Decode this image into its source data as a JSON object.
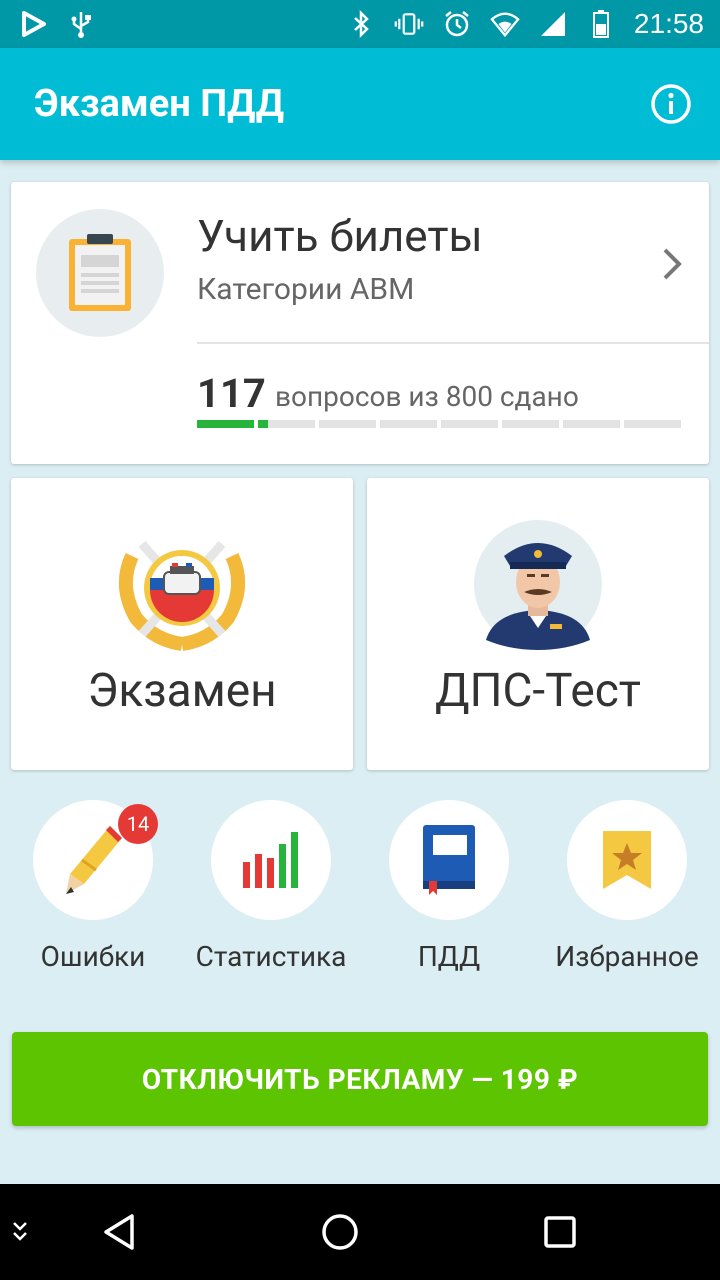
{
  "status_bar": {
    "time": "21:58",
    "icons": [
      "play-store-icon",
      "usb-icon",
      "bluetooth-icon",
      "vibrate-icon",
      "alarm-icon",
      "wifi-icon",
      "signal-icon",
      "battery-icon"
    ]
  },
  "app_bar": {
    "title": "Экзамен ПДД",
    "info_icon": "info-icon"
  },
  "learn_card": {
    "title": "Учить билеты",
    "subtitle": "Категории ABM",
    "passed_count": "117",
    "passed_text": "вопросов из 800 сдано",
    "progress_fraction": 0.146,
    "segments": 8,
    "accent_color": "#27b43a"
  },
  "exam_card": {
    "label": "Экзамен",
    "icon": "police-emblem-icon"
  },
  "dps_card": {
    "label": "ДПС-Тест",
    "icon": "police-officer-icon"
  },
  "shortcuts": [
    {
      "label": "Ошибки",
      "icon": "pencil-icon",
      "badge": "14"
    },
    {
      "label": "Статистика",
      "icon": "bar-chart-icon"
    },
    {
      "label": "ПДД",
      "icon": "book-icon"
    },
    {
      "label": "Избранное",
      "icon": "bookmark-star-icon"
    }
  ],
  "remove_ads_button": {
    "label": "ОТКЛЮЧИТЬ РЕКЛАМУ — 199 ₽",
    "color": "#5cc400"
  },
  "colors": {
    "status_bar": "#0097a7",
    "app_bar": "#00bcd4",
    "background": "#dbeef3"
  }
}
